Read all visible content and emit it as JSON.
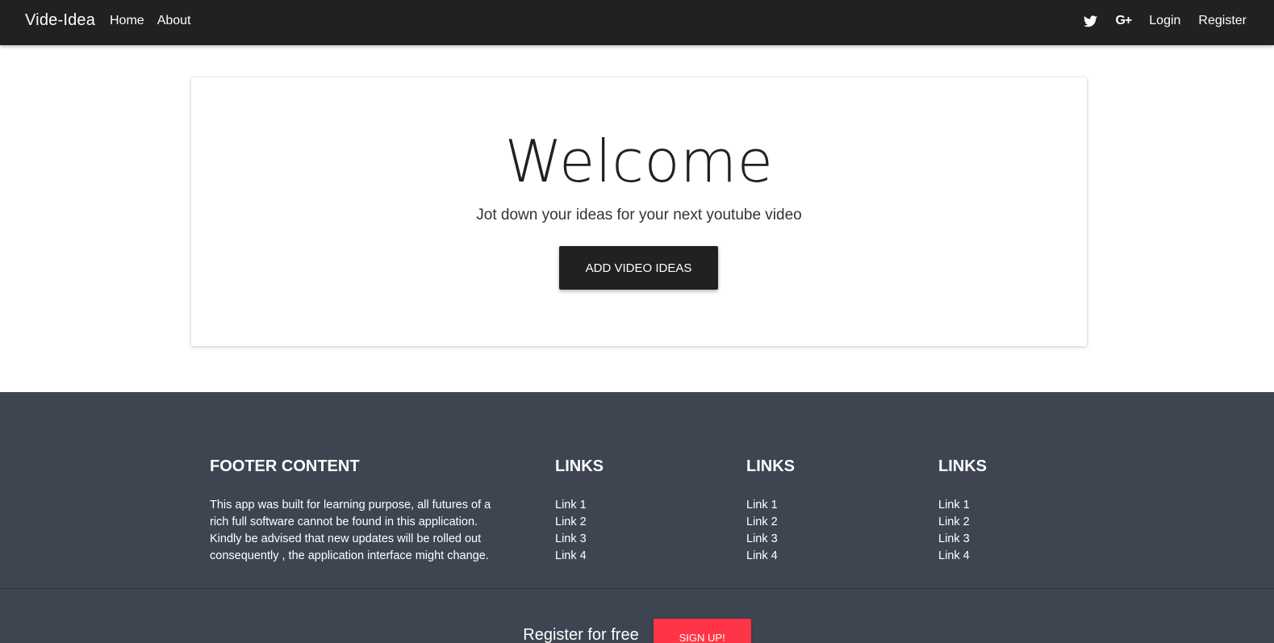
{
  "navbar": {
    "brand": "Vide-Idea",
    "left_links": [
      "Home",
      "About"
    ],
    "right_links": [
      "Login",
      "Register"
    ],
    "icons": [
      "twitter-icon",
      "google-plus-icon"
    ],
    "google_plus_text": "G+"
  },
  "hero": {
    "title": "Welcome",
    "subtitle": "Jot down your ideas for your next youtube video",
    "button_label": "ADD VIDEO IDEAS"
  },
  "footer": {
    "content_title": "FOOTER CONTENT",
    "content_text": "This app was built for learning purpose, all futures of a rich full software cannot be found in this application. Kindly be advised that new updates will be rolled out consequently , the application interface might change.",
    "link_columns": [
      {
        "title": "LINKS",
        "links": [
          "Link 1",
          "Link 2",
          "Link 3",
          "Link 4"
        ]
      },
      {
        "title": "LINKS",
        "links": [
          "Link 1",
          "Link 2",
          "Link 3",
          "Link 4"
        ]
      },
      {
        "title": "LINKS",
        "links": [
          "Link 1",
          "Link 2",
          "Link 3",
          "Link 4"
        ]
      }
    ],
    "cta_text": "Register for free",
    "cta_button": "SIGN UP!"
  },
  "colors": {
    "navbar_bg": "#212121",
    "footer_bg": "#3e4551",
    "signup_red": "#ff3547"
  }
}
